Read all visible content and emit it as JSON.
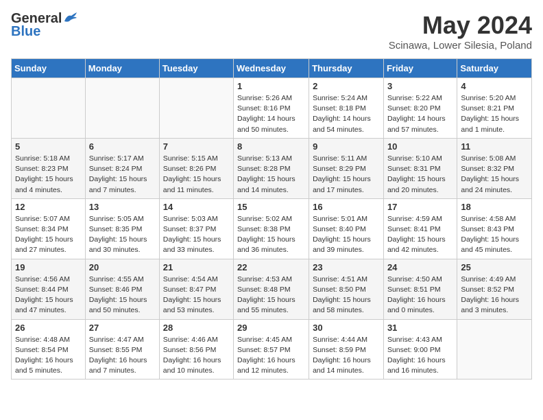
{
  "header": {
    "logo_general": "General",
    "logo_blue": "Blue",
    "title": "May 2024",
    "location": "Scinawa, Lower Silesia, Poland"
  },
  "days_of_week": [
    "Sunday",
    "Monday",
    "Tuesday",
    "Wednesday",
    "Thursday",
    "Friday",
    "Saturday"
  ],
  "weeks": [
    [
      {
        "day": "",
        "info": ""
      },
      {
        "day": "",
        "info": ""
      },
      {
        "day": "",
        "info": ""
      },
      {
        "day": "1",
        "info": "Sunrise: 5:26 AM\nSunset: 8:16 PM\nDaylight: 14 hours\nand 50 minutes."
      },
      {
        "day": "2",
        "info": "Sunrise: 5:24 AM\nSunset: 8:18 PM\nDaylight: 14 hours\nand 54 minutes."
      },
      {
        "day": "3",
        "info": "Sunrise: 5:22 AM\nSunset: 8:20 PM\nDaylight: 14 hours\nand 57 minutes."
      },
      {
        "day": "4",
        "info": "Sunrise: 5:20 AM\nSunset: 8:21 PM\nDaylight: 15 hours\nand 1 minute."
      }
    ],
    [
      {
        "day": "5",
        "info": "Sunrise: 5:18 AM\nSunset: 8:23 PM\nDaylight: 15 hours\nand 4 minutes."
      },
      {
        "day": "6",
        "info": "Sunrise: 5:17 AM\nSunset: 8:24 PM\nDaylight: 15 hours\nand 7 minutes."
      },
      {
        "day": "7",
        "info": "Sunrise: 5:15 AM\nSunset: 8:26 PM\nDaylight: 15 hours\nand 11 minutes."
      },
      {
        "day": "8",
        "info": "Sunrise: 5:13 AM\nSunset: 8:28 PM\nDaylight: 15 hours\nand 14 minutes."
      },
      {
        "day": "9",
        "info": "Sunrise: 5:11 AM\nSunset: 8:29 PM\nDaylight: 15 hours\nand 17 minutes."
      },
      {
        "day": "10",
        "info": "Sunrise: 5:10 AM\nSunset: 8:31 PM\nDaylight: 15 hours\nand 20 minutes."
      },
      {
        "day": "11",
        "info": "Sunrise: 5:08 AM\nSunset: 8:32 PM\nDaylight: 15 hours\nand 24 minutes."
      }
    ],
    [
      {
        "day": "12",
        "info": "Sunrise: 5:07 AM\nSunset: 8:34 PM\nDaylight: 15 hours\nand 27 minutes."
      },
      {
        "day": "13",
        "info": "Sunrise: 5:05 AM\nSunset: 8:35 PM\nDaylight: 15 hours\nand 30 minutes."
      },
      {
        "day": "14",
        "info": "Sunrise: 5:03 AM\nSunset: 8:37 PM\nDaylight: 15 hours\nand 33 minutes."
      },
      {
        "day": "15",
        "info": "Sunrise: 5:02 AM\nSunset: 8:38 PM\nDaylight: 15 hours\nand 36 minutes."
      },
      {
        "day": "16",
        "info": "Sunrise: 5:01 AM\nSunset: 8:40 PM\nDaylight: 15 hours\nand 39 minutes."
      },
      {
        "day": "17",
        "info": "Sunrise: 4:59 AM\nSunset: 8:41 PM\nDaylight: 15 hours\nand 42 minutes."
      },
      {
        "day": "18",
        "info": "Sunrise: 4:58 AM\nSunset: 8:43 PM\nDaylight: 15 hours\nand 45 minutes."
      }
    ],
    [
      {
        "day": "19",
        "info": "Sunrise: 4:56 AM\nSunset: 8:44 PM\nDaylight: 15 hours\nand 47 minutes."
      },
      {
        "day": "20",
        "info": "Sunrise: 4:55 AM\nSunset: 8:46 PM\nDaylight: 15 hours\nand 50 minutes."
      },
      {
        "day": "21",
        "info": "Sunrise: 4:54 AM\nSunset: 8:47 PM\nDaylight: 15 hours\nand 53 minutes."
      },
      {
        "day": "22",
        "info": "Sunrise: 4:53 AM\nSunset: 8:48 PM\nDaylight: 15 hours\nand 55 minutes."
      },
      {
        "day": "23",
        "info": "Sunrise: 4:51 AM\nSunset: 8:50 PM\nDaylight: 15 hours\nand 58 minutes."
      },
      {
        "day": "24",
        "info": "Sunrise: 4:50 AM\nSunset: 8:51 PM\nDaylight: 16 hours\nand 0 minutes."
      },
      {
        "day": "25",
        "info": "Sunrise: 4:49 AM\nSunset: 8:52 PM\nDaylight: 16 hours\nand 3 minutes."
      }
    ],
    [
      {
        "day": "26",
        "info": "Sunrise: 4:48 AM\nSunset: 8:54 PM\nDaylight: 16 hours\nand 5 minutes."
      },
      {
        "day": "27",
        "info": "Sunrise: 4:47 AM\nSunset: 8:55 PM\nDaylight: 16 hours\nand 7 minutes."
      },
      {
        "day": "28",
        "info": "Sunrise: 4:46 AM\nSunset: 8:56 PM\nDaylight: 16 hours\nand 10 minutes."
      },
      {
        "day": "29",
        "info": "Sunrise: 4:45 AM\nSunset: 8:57 PM\nDaylight: 16 hours\nand 12 minutes."
      },
      {
        "day": "30",
        "info": "Sunrise: 4:44 AM\nSunset: 8:59 PM\nDaylight: 16 hours\nand 14 minutes."
      },
      {
        "day": "31",
        "info": "Sunrise: 4:43 AM\nSunset: 9:00 PM\nDaylight: 16 hours\nand 16 minutes."
      },
      {
        "day": "",
        "info": ""
      }
    ]
  ]
}
